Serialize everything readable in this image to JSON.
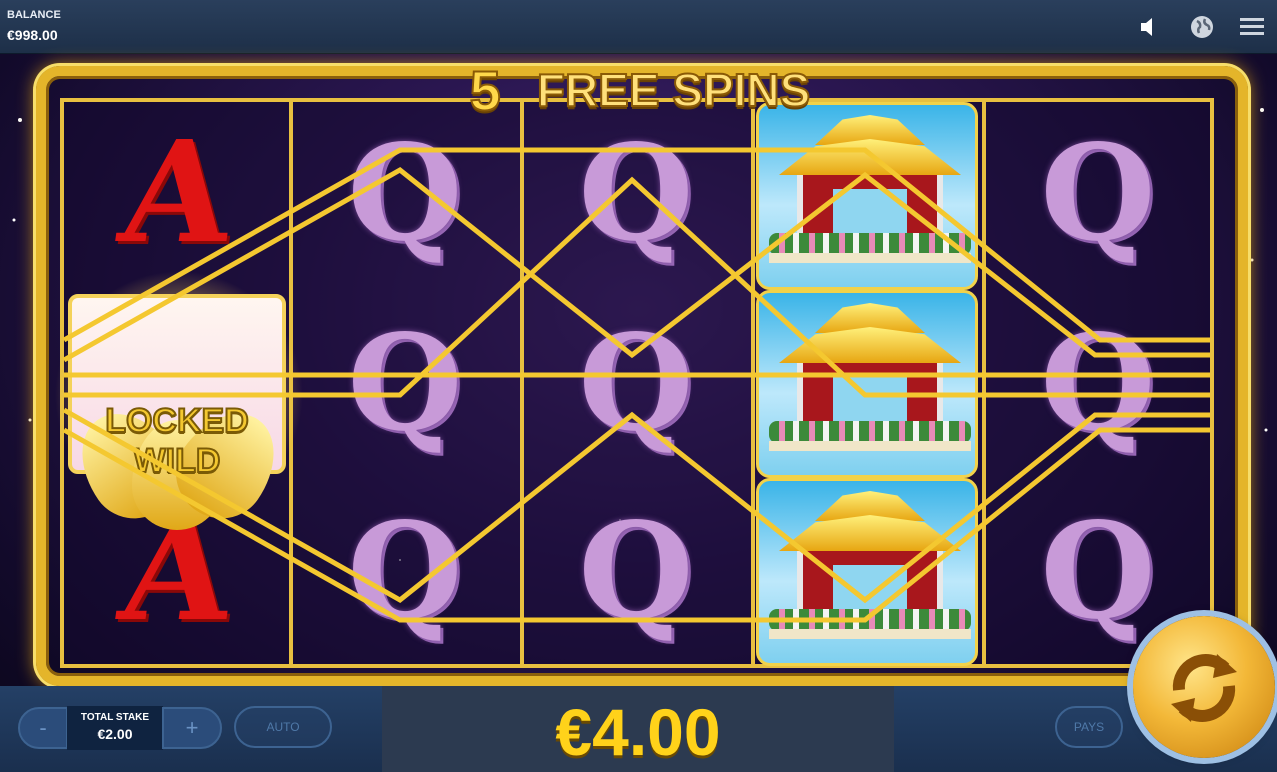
{
  "topbar": {
    "balance_label": "BALANCE",
    "balance_value": "€998.00",
    "icons": [
      "sound-icon",
      "globe-icon",
      "menu-icon"
    ]
  },
  "banner": {
    "free_spins_count": "5",
    "free_spins_label": "FREE SPINS"
  },
  "reels": {
    "columns": [
      [
        "A",
        "LOCKED WILD",
        "A"
      ],
      [
        "Q",
        "Q",
        "Q"
      ],
      [
        "Q",
        "Q",
        "Q"
      ],
      [
        "pagoda",
        "pagoda",
        "pagoda"
      ],
      [
        "Q",
        "Q",
        "Q"
      ]
    ],
    "locked_wild_line1": "LOCKED",
    "locked_wild_line2": "WILD"
  },
  "win": {
    "value": "€4.00"
  },
  "controls": {
    "minus_label": "-",
    "plus_label": "+",
    "total_stake_label": "TOTAL STAKE",
    "total_stake_value": "€2.00",
    "auto_label": "AUTO",
    "pays_label": "PAYS"
  },
  "colors": {
    "frame_gold": "#e4b52a",
    "win_text": "#ffd21a",
    "bar_blue": "#1d2f48"
  }
}
